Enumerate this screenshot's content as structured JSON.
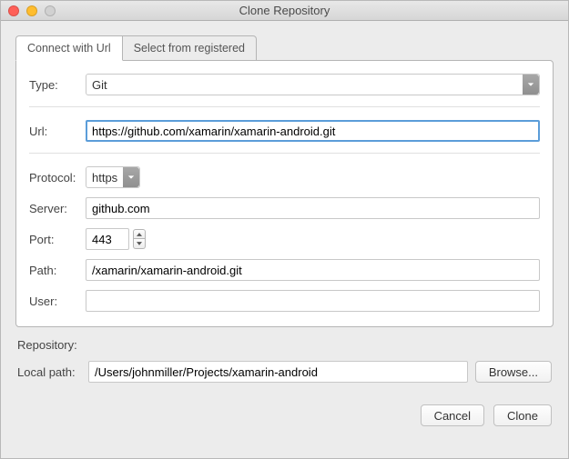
{
  "window": {
    "title": "Clone Repository"
  },
  "tabs": {
    "connect": "Connect with Url",
    "registered": "Select from registered"
  },
  "labels": {
    "type": "Type:",
    "url": "Url:",
    "protocol": "Protocol:",
    "server": "Server:",
    "port": "Port:",
    "path": "Path:",
    "user": "User:",
    "repository": "Repository:",
    "localpath": "Local path:"
  },
  "values": {
    "type": "Git",
    "url": "https://github.com/xamarin/xamarin-android.git",
    "protocol": "https",
    "server": "github.com",
    "port": "443",
    "path": "/xamarin/xamarin-android.git",
    "user": "",
    "localpath": "/Users/johnmiller/Projects/xamarin-android"
  },
  "buttons": {
    "browse": "Browse...",
    "cancel": "Cancel",
    "clone": "Clone"
  }
}
